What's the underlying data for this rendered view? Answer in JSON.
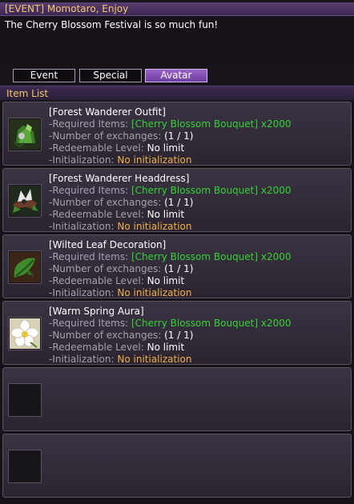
{
  "title": "[EVENT] Momotaro, Enjoy",
  "message": "The Cherry Blossom Festival is so much fun!",
  "tabs": [
    {
      "label": "Event"
    },
    {
      "label": "Special"
    },
    {
      "label": "Avatar",
      "active": true
    }
  ],
  "list_header": "Item List",
  "labels": {
    "required": "-Required Items: ",
    "exchanges": "-Number of exchanges: ",
    "level": "-Redeemable Level: ",
    "init": "-Initialization: "
  },
  "items": [
    {
      "name": "[Forest Wanderer Outfit]",
      "icon": "outfit-icon",
      "required": "[Cherry Blossom Bouquet] x2000",
      "exchanges": "(1 / 1)",
      "level": "No limit",
      "init": "No initialization"
    },
    {
      "name": "[Forest Wanderer Headdress]",
      "icon": "headdress-icon",
      "required": "[Cherry Blossom Bouquet] x2000",
      "exchanges": "(1 / 1)",
      "level": "No limit",
      "init": "No initialization"
    },
    {
      "name": "[Wilted Leaf Decoration]",
      "icon": "leaf-icon",
      "required": "[Cherry Blossom Bouquet] x2000",
      "exchanges": "(1 / 1)",
      "level": "No limit",
      "init": "No initialization"
    },
    {
      "name": "[Warm Spring Aura]",
      "icon": "flower-aura-icon",
      "required": "[Cherry Blossom Bouquet] x2000",
      "exchanges": "(1 / 1)",
      "level": "No limit",
      "init": "No initialization"
    }
  ]
}
